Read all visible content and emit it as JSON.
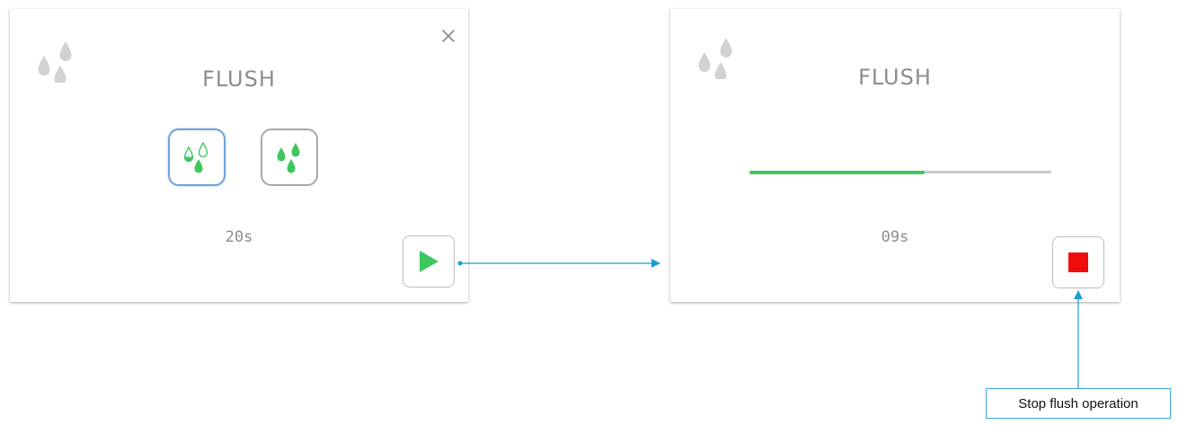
{
  "colors": {
    "accent_green": "#3fc75f",
    "stop_red": "#f20d0d",
    "selected_blue": "#6fa3dc",
    "connector_blue": "#1a9ad6",
    "icon_grey": "#cfcfcf"
  },
  "flush_setup": {
    "title": "FLUSH",
    "app_icon": "water-drops-icon",
    "close_icon": "close-icon",
    "modes": [
      {
        "icon": "half-flush-icon",
        "selected": true
      },
      {
        "icon": "full-flush-icon",
        "selected": false
      }
    ],
    "duration": "20s",
    "start_icon": "play-icon"
  },
  "flush_running": {
    "title": "FLUSH",
    "app_icon": "water-drops-icon",
    "progress": 0.58,
    "remaining": "09s",
    "stop_icon": "stop-icon"
  },
  "annotation": {
    "label": "Stop flush operation"
  }
}
